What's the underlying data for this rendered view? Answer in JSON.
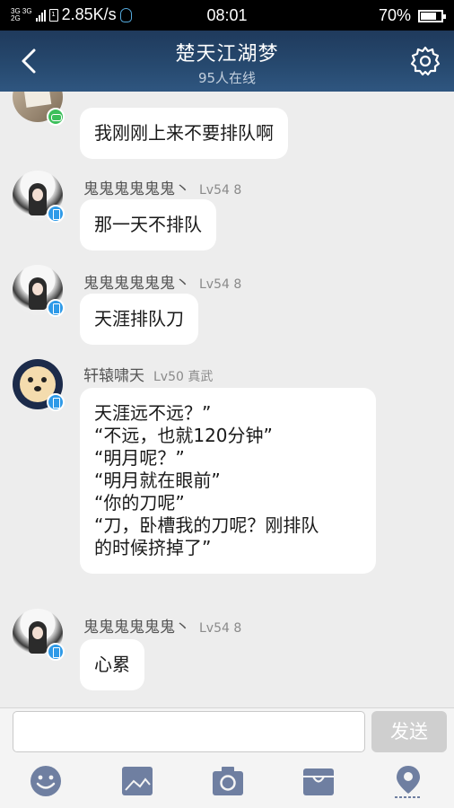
{
  "status_bar": {
    "network_top": "3G 3G",
    "network_bottom": "2G",
    "sim": "1",
    "speed": "2.85K/s",
    "time": "08:01",
    "battery": "70%"
  },
  "header": {
    "title": "楚天江湖梦",
    "subtitle": "95人在线"
  },
  "messages": [
    {
      "sender": "",
      "level": "",
      "text": "我刚刚上来不要排队啊",
      "badge": "game-icon"
    },
    {
      "sender": "鬼鬼鬼鬼鬼鬼丶",
      "level": "Lv54 8",
      "text": "那一天不排队",
      "badge": "phone-icon"
    },
    {
      "sender": "鬼鬼鬼鬼鬼鬼丶",
      "level": "Lv54 8",
      "text": "天涯排队刀",
      "badge": "phone-icon"
    },
    {
      "sender": "轩辕啸天",
      "level": "Lv50 真武",
      "text": "天涯远不远？”\n“不远，也就120分钟”\n“明月呢？”\n“明月就在眼前”\n“你的刀呢”\n“刀，卧槽我的刀呢？刚排队\n的时候挤掉了”",
      "badge": "phone-icon"
    },
    {
      "sender": "鬼鬼鬼鬼鬼鬼丶",
      "level": "Lv54 8",
      "text": "心累",
      "badge": "phone-icon"
    }
  ],
  "input": {
    "value": "",
    "placeholder": "",
    "send_label": "发送"
  },
  "toolbar": {
    "items": [
      "emoji-icon",
      "image-icon",
      "camera-icon",
      "box-icon",
      "location-icon"
    ]
  },
  "colors": {
    "header_bg": "#274a70",
    "chat_bg": "#ededed",
    "bubble_bg": "#ffffff",
    "toolbar_icon": "#6f7fa1"
  }
}
